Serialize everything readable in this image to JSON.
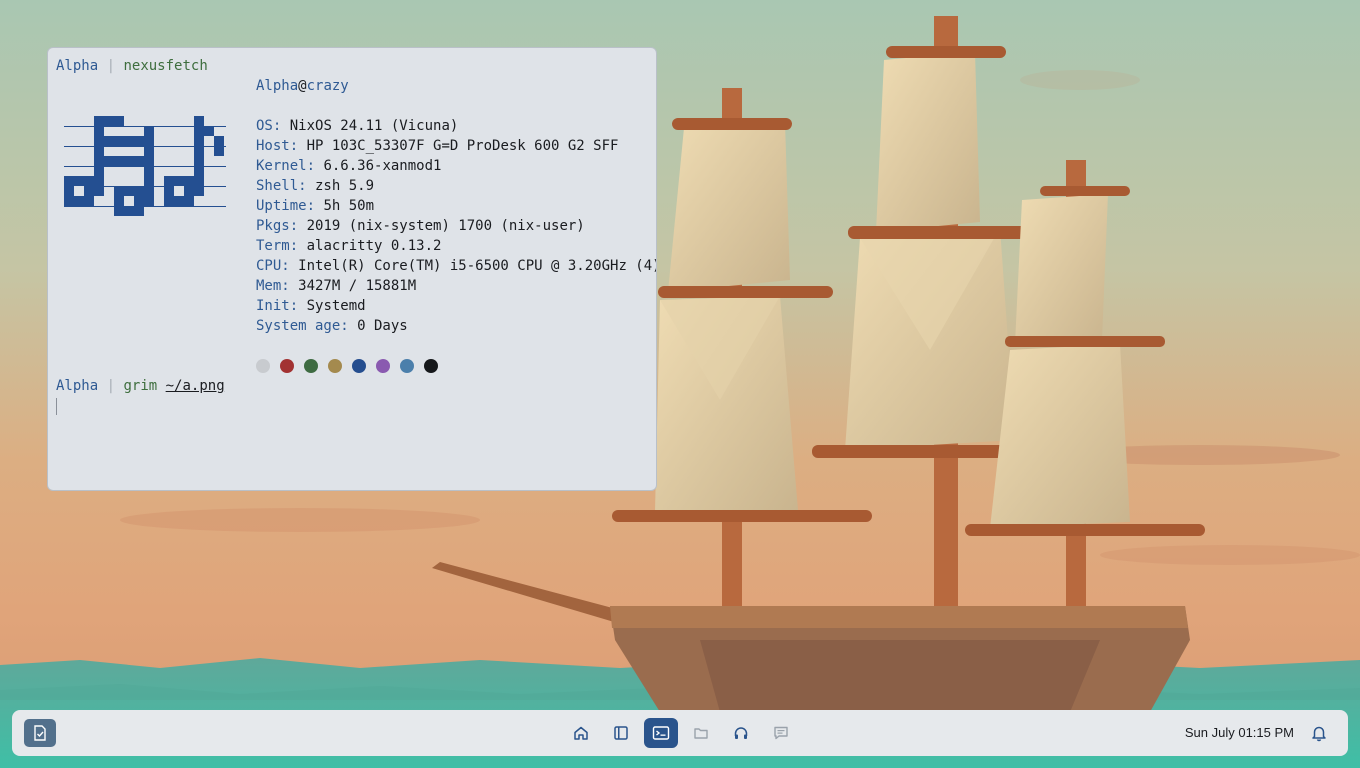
{
  "terminal": {
    "prompt1": {
      "user": "Alpha",
      "separator": "|",
      "command": "nexusfetch"
    },
    "header": {
      "user": "Alpha",
      "at": "@",
      "host": "crazy"
    },
    "info": [
      {
        "key": "OS:",
        "value": " NixOS 24.11 (Vicuna)"
      },
      {
        "key": "Host:",
        "value": " HP 103C_53307F G=D ProDesk 600 G2 SFF"
      },
      {
        "key": "Kernel:",
        "value": " 6.6.36-xanmod1"
      },
      {
        "key": "Shell:",
        "value": " zsh 5.9"
      },
      {
        "key": "Uptime:",
        "value": " 5h 50m"
      },
      {
        "key": "Pkgs:",
        "value": " 2019 (nix-system) 1700 (nix-user)"
      },
      {
        "key": "Term:",
        "value": " alacritty 0.13.2"
      },
      {
        "key": "CPU:",
        "value": " Intel(R) Core(TM) i5-6500 CPU @ 3.20GHz (4)"
      },
      {
        "key": "Mem:",
        "value": " 3427M / 15881M"
      },
      {
        "key": "Init:",
        "value": " Systemd"
      },
      {
        "key": "System age:",
        "value": " 0 Days"
      }
    ],
    "palette": [
      "#c8cbcf",
      "#a23232",
      "#3e6b42",
      "#a48a4e",
      "#254e8f",
      "#8a5ab0",
      "#4b7fab",
      "#16181b"
    ],
    "prompt2": {
      "user": "Alpha",
      "separator": "|",
      "command": "grim",
      "argument": "~/a.png"
    }
  },
  "taskbar": {
    "start_icon": "task-check-icon",
    "dock": [
      {
        "name": "home",
        "icon": "home-icon",
        "active": false
      },
      {
        "name": "sidebar",
        "icon": "sidebar-panel-icon",
        "active": false
      },
      {
        "name": "terminal",
        "icon": "terminal-icon",
        "active": true
      },
      {
        "name": "files",
        "icon": "folder-icon",
        "active": false
      },
      {
        "name": "music",
        "icon": "headphones-icon",
        "active": false
      },
      {
        "name": "messages",
        "icon": "chat-icon",
        "active": false
      }
    ],
    "clock": "Sun July 01:15 PM",
    "notification_icon": "bell-icon"
  },
  "colors": {
    "accent": "#2a548c",
    "terminal_bg": "#dfe3e8",
    "taskbar_bg": "#e6e9ec"
  }
}
